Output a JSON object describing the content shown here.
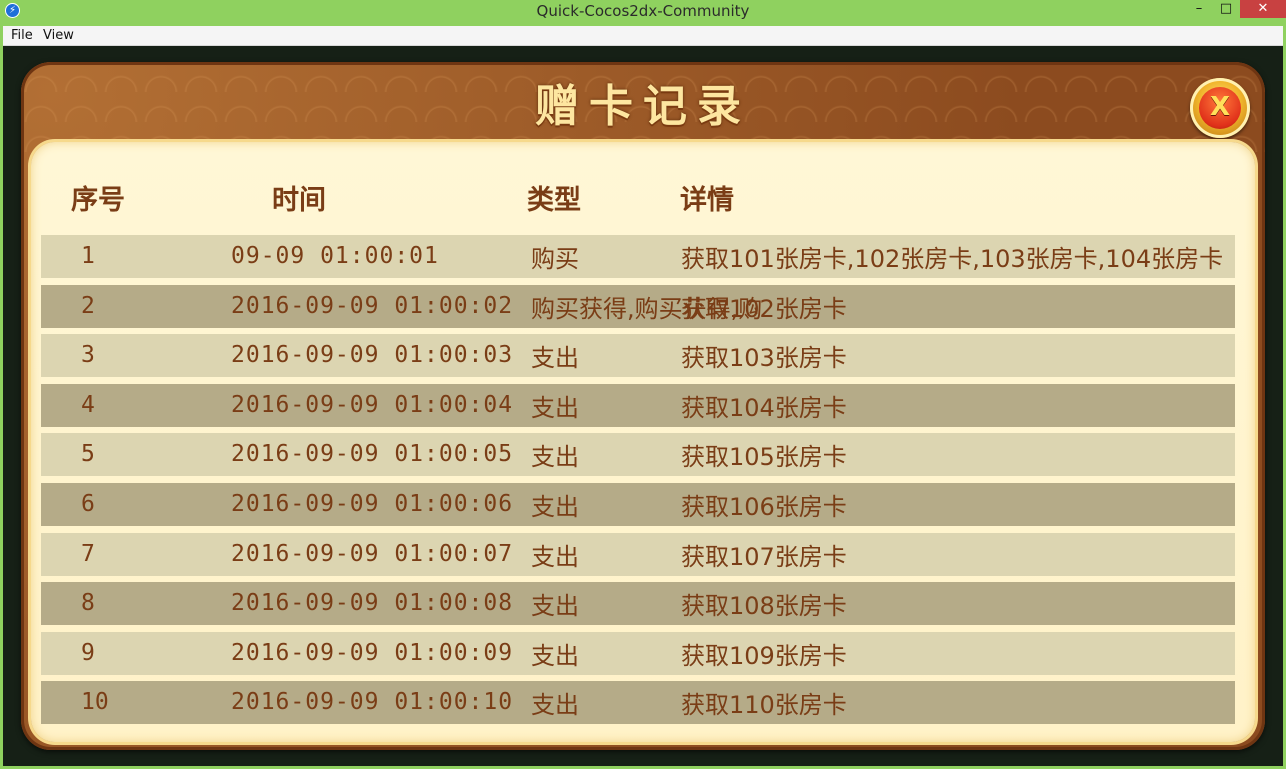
{
  "window": {
    "title": "Quick-Cocos2dx-Community",
    "minimize": "–",
    "maximize": "□",
    "close": "✕"
  },
  "menu": {
    "file": "File",
    "view": "View"
  },
  "dialog": {
    "title": "赠卡记录",
    "close_label": "X",
    "headers": {
      "num": "序号",
      "time": "时间",
      "type": "类型",
      "detail": "详情"
    },
    "rows": [
      {
        "num": "1",
        "time": "09-09 01:00:01",
        "type": "购买",
        "detail": "获取101张房卡,102张房卡,103张房卡,104张房卡"
      },
      {
        "num": "2",
        "time": "2016-09-09 01:00:02",
        "type": "购买获得,购买获得,购",
        "detail": "获取102张房卡"
      },
      {
        "num": "3",
        "time": "2016-09-09 01:00:03",
        "type": "支出",
        "detail": "获取103张房卡"
      },
      {
        "num": "4",
        "time": "2016-09-09 01:00:04",
        "type": "支出",
        "detail": "获取104张房卡"
      },
      {
        "num": "5",
        "time": "2016-09-09 01:00:05",
        "type": "支出",
        "detail": "获取105张房卡"
      },
      {
        "num": "6",
        "time": "2016-09-09 01:00:06",
        "type": "支出",
        "detail": "获取106张房卡"
      },
      {
        "num": "7",
        "time": "2016-09-09 01:00:07",
        "type": "支出",
        "detail": "获取107张房卡"
      },
      {
        "num": "8",
        "time": "2016-09-09 01:00:08",
        "type": "支出",
        "detail": "获取108张房卡"
      },
      {
        "num": "9",
        "time": "2016-09-09 01:00:09",
        "type": "支出",
        "detail": "获取109张房卡"
      },
      {
        "num": "10",
        "time": "2016-09-09 01:00:10",
        "type": "支出",
        "detail": "获取110张房卡"
      }
    ]
  }
}
